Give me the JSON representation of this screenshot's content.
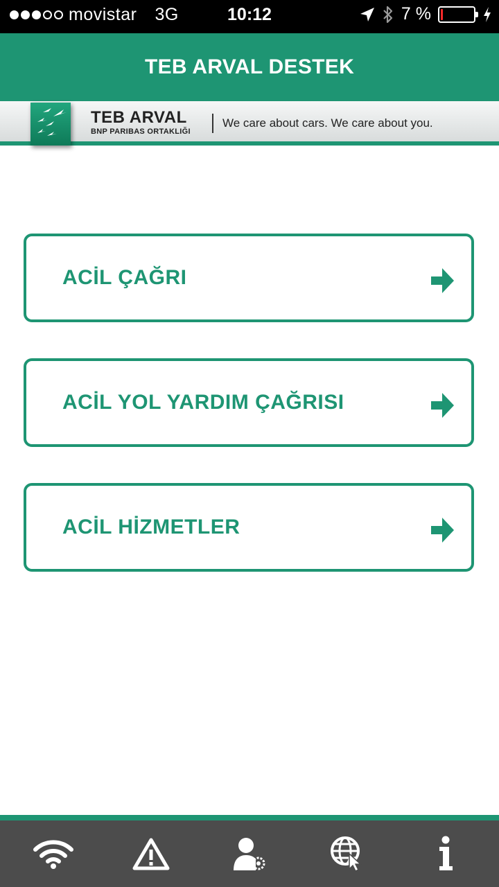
{
  "status_bar": {
    "carrier": "movistar",
    "network": "3G",
    "time": "10:12",
    "battery_text": "7 %",
    "battery_level": 0.07,
    "battery_color": "#ff2a2a"
  },
  "header": {
    "title": "TEB ARVAL DESTEK"
  },
  "brand": {
    "name": "TEB ARVAL",
    "subtitle": "BNP PARIBAS ORTAKLIĞI",
    "tagline": "We care about cars. We care about you."
  },
  "menu": {
    "items": [
      {
        "label": "ACİL ÇAĞRI",
        "icon": "arrow-right-icon"
      },
      {
        "label": "ACİL YOL YARDIM ÇAĞRISI",
        "icon": "arrow-right-icon"
      },
      {
        "label": "ACİL HİZMETLER",
        "icon": "arrow-right-icon"
      }
    ]
  },
  "tab_bar": {
    "items": [
      {
        "icon": "wifi-icon"
      },
      {
        "icon": "warning-icon"
      },
      {
        "icon": "user-settings-icon"
      },
      {
        "icon": "globe-cursor-icon"
      },
      {
        "icon": "info-icon"
      }
    ]
  },
  "colors": {
    "accent": "#1e9573",
    "tab_bar_bg": "#4c4c4c",
    "status_bar_bg": "#000000"
  }
}
